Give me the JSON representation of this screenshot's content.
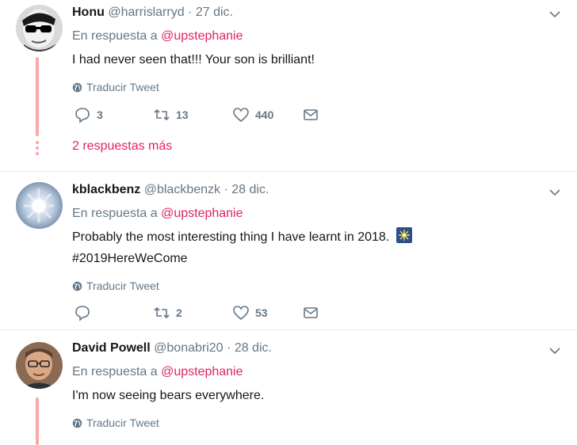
{
  "tweets": [
    {
      "name": "Honu",
      "handle": "@harrislarryd",
      "separator": "·",
      "date": "27 dic.",
      "reply_prefix": "En respuesta a",
      "reply_mention": "@upstephanie",
      "text": "I had never seen that!!! Your son is brilliant!",
      "translate": "Traducir Tweet",
      "replies": "3",
      "retweets": "13",
      "likes": "440",
      "more_replies": "2 respuestas más"
    },
    {
      "name": "kblackbenz",
      "handle": "@blackbenzk",
      "separator": "·",
      "date": "28 dic.",
      "reply_prefix": "En respuesta a",
      "reply_mention": "@upstephanie",
      "text": "Probably the most interesting thing I have learnt in 2018.",
      "hashtag": "#2019HereWeCome",
      "translate": "Traducir Tweet",
      "replies": "",
      "retweets": "2",
      "likes": "53"
    },
    {
      "name": "David Powell",
      "handle": "@bonabri20",
      "separator": "·",
      "date": "28 dic.",
      "reply_prefix": "En respuesta a",
      "reply_mention": "@upstephanie",
      "text": "I'm now seeing bears everywhere.",
      "translate": "Traducir Tweet"
    }
  ],
  "icons": [
    "more-chevron-icon",
    "globe-icon",
    "reply-icon",
    "retweet-icon",
    "like-icon",
    "message-icon",
    "fireworks-emoji-icon"
  ],
  "colors": {
    "accent": "#e0245e",
    "muted": "#657786",
    "thread": "#f8a7ab"
  }
}
